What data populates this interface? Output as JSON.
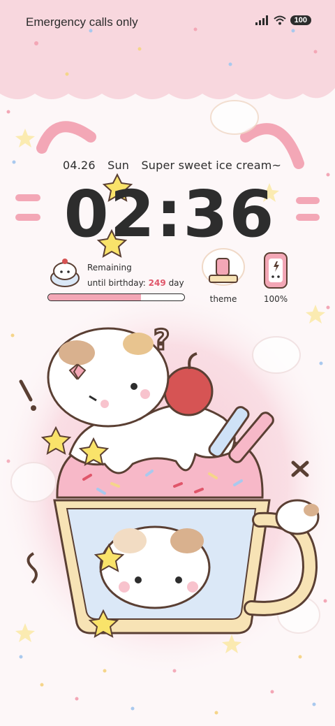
{
  "status_bar": {
    "carrier_text": "Emergency calls only",
    "battery_level": "100"
  },
  "lockscreen": {
    "date": "04.26",
    "weekday": "Sun",
    "theme_title": "Super sweet ice cream~",
    "time": "02:36"
  },
  "birthday_widget": {
    "line1": "Remaining",
    "line2_prefix": "until birthday:",
    "days": "249",
    "unit": "day",
    "progress_fraction": 0.68
  },
  "theme_widget": {
    "label": "theme"
  },
  "battery_widget": {
    "label": "100%"
  },
  "colors": {
    "pink_band": "#f8d7de",
    "pink_glow": "#f6c5d0",
    "text_dark": "#2d2d2d",
    "accent_red": "#e0566a",
    "cream": "#f7e3b5",
    "cup_blue": "#dbe8f7"
  },
  "icons": [
    "signal-icon",
    "wifi-icon",
    "battery-icon",
    "gift-cake-icon",
    "theme-cat-icon",
    "phone-cat-icon",
    "star-icon",
    "question-mark-icon",
    "exclamation-icon"
  ]
}
